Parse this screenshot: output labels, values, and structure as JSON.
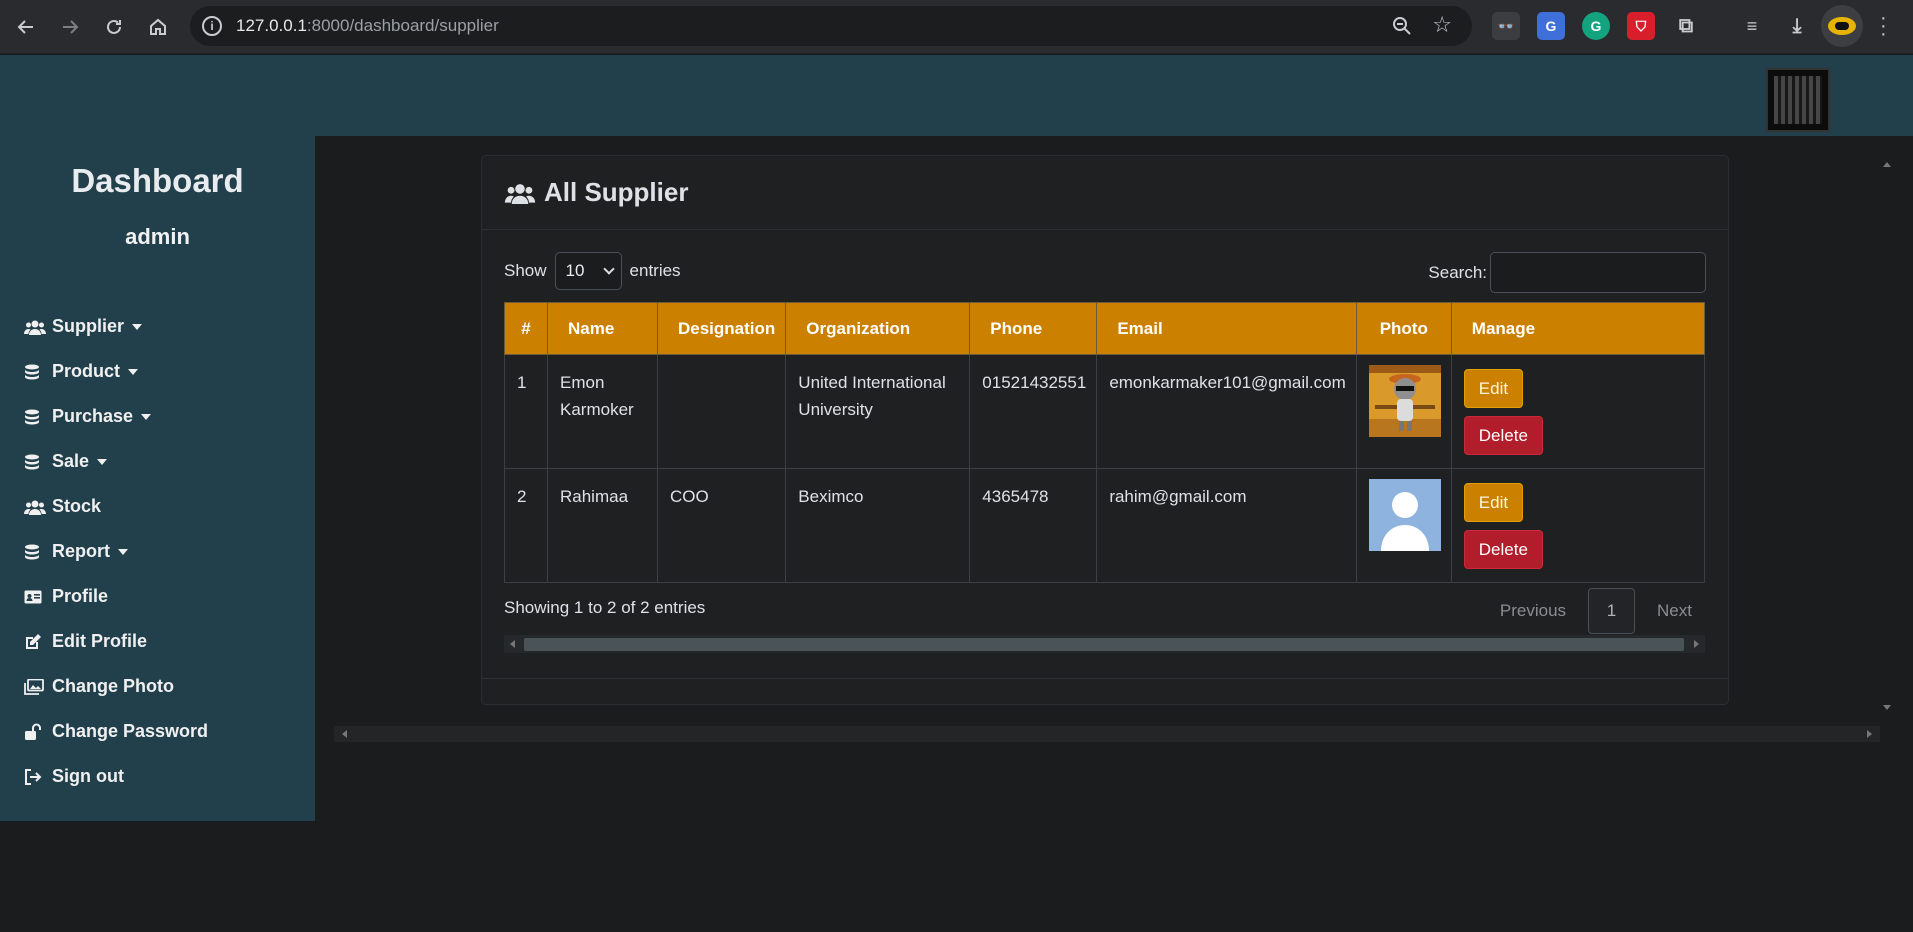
{
  "browser": {
    "url_host": "127.0.0.1",
    "url_rest": ":8000/dashboard/supplier"
  },
  "sidebar": {
    "brand": "Dashboard",
    "role": "admin",
    "items": [
      {
        "label": "Supplier",
        "icon": "users-icon",
        "dropdown": true
      },
      {
        "label": "Product",
        "icon": "database-icon",
        "dropdown": true
      },
      {
        "label": "Purchase",
        "icon": "database-icon",
        "dropdown": true
      },
      {
        "label": "Sale",
        "icon": "database-icon",
        "dropdown": true
      },
      {
        "label": "Stock",
        "icon": "users-icon",
        "dropdown": false
      },
      {
        "label": "Report",
        "icon": "database-icon",
        "dropdown": true
      },
      {
        "label": "Profile",
        "icon": "id-card-icon",
        "dropdown": false
      },
      {
        "label": "Edit Profile",
        "icon": "edit-icon",
        "dropdown": false
      },
      {
        "label": "Change Photo",
        "icon": "images-icon",
        "dropdown": false
      },
      {
        "label": "Change Password",
        "icon": "unlock-icon",
        "dropdown": false
      },
      {
        "label": "Sign out",
        "icon": "sign-out-icon",
        "dropdown": false
      }
    ]
  },
  "card": {
    "title": "All Supplier"
  },
  "table_controls": {
    "show_label": "Show",
    "entries_value": "10",
    "entries_label": "entries",
    "search_label": "Search:"
  },
  "table": {
    "headers": [
      "#",
      "Name",
      "Designation",
      "Organization",
      "Phone",
      "Email",
      "Photo",
      "Manage"
    ],
    "rows": [
      {
        "num": "1",
        "name": "Emon Karmoker",
        "designation": "",
        "organization": "United International University",
        "phone": "01521432551",
        "email": "emonkarmaker101@gmail.com",
        "photo": "cartoon-avatar"
      },
      {
        "num": "2",
        "name": "Rahimaa",
        "designation": "COO",
        "organization": "Beximco",
        "phone": "4365478",
        "email": "rahim@gmail.com",
        "photo": "default-avatar"
      }
    ],
    "edit_label": "Edit",
    "delete_label": "Delete"
  },
  "footer": {
    "info": "Showing 1 to 2 of 2 entries",
    "previous": "Previous",
    "page": "1",
    "next": "Next"
  },
  "colors": {
    "sidebar_bg": "#223f4c",
    "header_bg": "#cc8000",
    "delete_btn": "#b11d2b"
  }
}
